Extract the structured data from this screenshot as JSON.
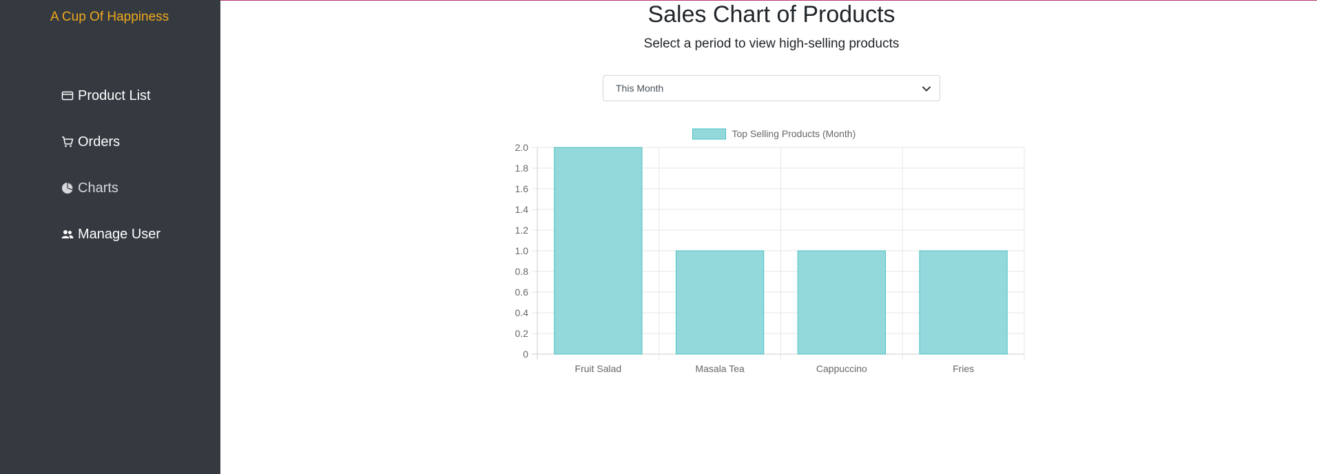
{
  "sidebar": {
    "brand": "A Cup Of Happiness",
    "items": [
      {
        "label": "Product List",
        "icon": "card-icon"
      },
      {
        "label": "Orders",
        "icon": "cart-icon"
      },
      {
        "label": "Charts",
        "icon": "pie-chart-icon"
      },
      {
        "label": "Manage User",
        "icon": "users-icon"
      }
    ]
  },
  "main": {
    "title": "Sales Chart of Products",
    "subtitle": "Select a period to view high-selling products",
    "period_select": {
      "value": "This Month"
    }
  },
  "colors": {
    "sidebar_bg": "#343a40",
    "brand": "#f0a81c",
    "bar_fill": "#93d9db",
    "bar_border": "#4bc0c0"
  },
  "chart_data": {
    "type": "bar",
    "categories": [
      "Fruit Salad",
      "Masala Tea",
      "Cappuccino",
      "Fries"
    ],
    "series": [
      {
        "name": "Top Selling Products (Month)",
        "values": [
          2,
          1,
          1,
          1
        ]
      }
    ],
    "ylim": [
      0,
      2
    ],
    "yticks": [
      "0",
      "0.2",
      "0.4",
      "0.6",
      "0.8",
      "1.0",
      "1.2",
      "1.4",
      "1.6",
      "1.8",
      "2.0"
    ],
    "grid": true,
    "legend": "top"
  }
}
